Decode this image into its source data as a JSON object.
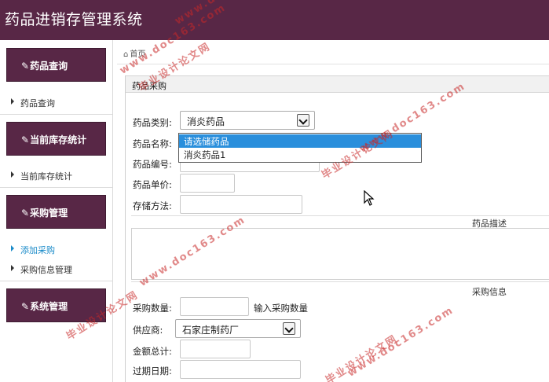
{
  "app": {
    "title": "药品进销存管理系统"
  },
  "sidebar": {
    "sections": [
      {
        "header": "药品查询",
        "items": [
          {
            "label": "药品查询",
            "active": false
          }
        ]
      },
      {
        "header": "当前库存统计",
        "items": [
          {
            "label": "当前库存统计",
            "active": false
          }
        ]
      },
      {
        "header": "采购管理",
        "items": [
          {
            "label": "添加采购",
            "active": true
          },
          {
            "label": "采购信息管理",
            "active": false
          }
        ]
      },
      {
        "header": "系统管理",
        "items": []
      }
    ],
    "header_icon": "edit-icon"
  },
  "breadcrumb": {
    "home_icon": "home-icon",
    "label": "首页"
  },
  "panel": {
    "title": "药品采购"
  },
  "form": {
    "category_label": "药品类别:",
    "category_value": "消炎药品",
    "name_label": "药品名称:",
    "code_label": "药品编号:",
    "price_label": "药品单价:",
    "storage_label": "存储方法:",
    "description_label": "药品描述",
    "purchase_info_label": "采购信息",
    "quantity_label": "采购数量:",
    "quantity_hint": "输入采购数量",
    "supplier_label": "供应商:",
    "supplier_value": "石家庄制药厂",
    "total_label": "金额总计:",
    "expiry_label": "过期日期:"
  },
  "dropdown": {
    "options": [
      {
        "label": "请选储药品",
        "highlighted": true
      },
      {
        "label": "消炎药品1",
        "highlighted": false
      }
    ]
  },
  "watermark": {
    "cn": "毕业设计论文网",
    "url": "www.doc163.com"
  },
  "colors": {
    "brand": "#582746",
    "active_link": "#1a8bc9",
    "highlight": "#2a8fdc",
    "watermark": "#c82828"
  }
}
